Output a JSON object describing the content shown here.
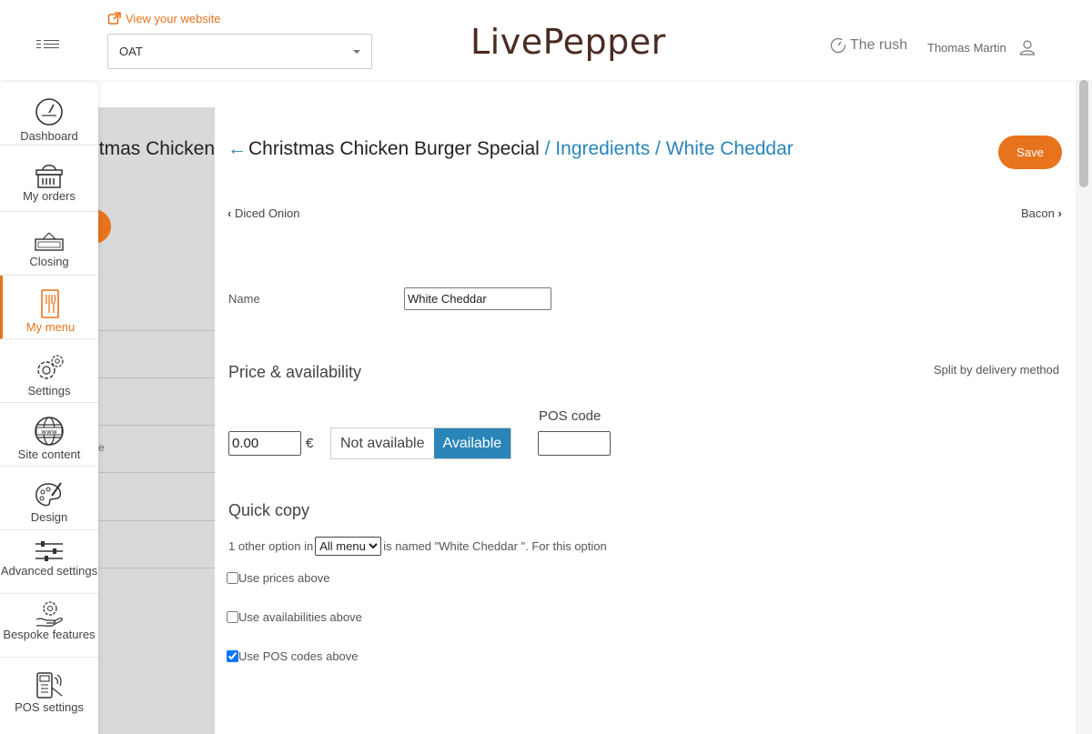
{
  "header": {
    "view_website": "View your website",
    "site_selected": "OAT",
    "logo_text": "LivePepper",
    "rush": "The rush",
    "user_name": "Thomas Martin"
  },
  "sidebar": {
    "items": [
      {
        "label": "Dashboard",
        "icon": "gauge-icon"
      },
      {
        "label": "My orders",
        "icon": "basket-icon"
      },
      {
        "label": "Closing",
        "icon": "closed-sign-icon"
      },
      {
        "label": "My menu",
        "icon": "menu-icon",
        "active": true
      },
      {
        "label": "Settings",
        "icon": "gear-icon"
      },
      {
        "label": "Site content",
        "icon": "globe-icon"
      },
      {
        "label": "Design",
        "icon": "palette-icon"
      },
      {
        "label": "Advanced settings",
        "icon": "sliders-icon"
      },
      {
        "label": "Bespoke features",
        "icon": "hand-gear-icon"
      },
      {
        "label": "POS settings",
        "icon": "pos-terminal-icon"
      }
    ]
  },
  "background_page": {
    "title": "Christmas Chicken",
    "fragment": "e"
  },
  "panel": {
    "back_arrow": "←",
    "dish": "Christmas Chicken Burger Special",
    "crumb": " / Ingredients / White Cheddar",
    "save_label": "Save",
    "prev": "Diced Onion",
    "next": "Bacon",
    "name_label": "Name",
    "name_value": "White Cheddar",
    "price_section": "Price & availability",
    "split_link": "Split by delivery method",
    "pos_label": "POS code",
    "price_value": "0.00",
    "currency": "€",
    "not_available": "Not available",
    "available": "Available",
    "pos_value": "",
    "quick_copy": "Quick copy",
    "copy_prefix": "1 other option in",
    "copy_select": "All menu",
    "copy_suffix": "is named \"White Cheddar \". For this option",
    "use_prices": "Use prices above",
    "use_availabilities": "Use availabilities above",
    "use_pos_codes": "Use POS codes above",
    "use_prices_checked": false,
    "use_availabilities_checked": false,
    "use_pos_codes_checked": true
  },
  "colors": {
    "accent": "#e8731d",
    "link": "#2a85b8"
  }
}
